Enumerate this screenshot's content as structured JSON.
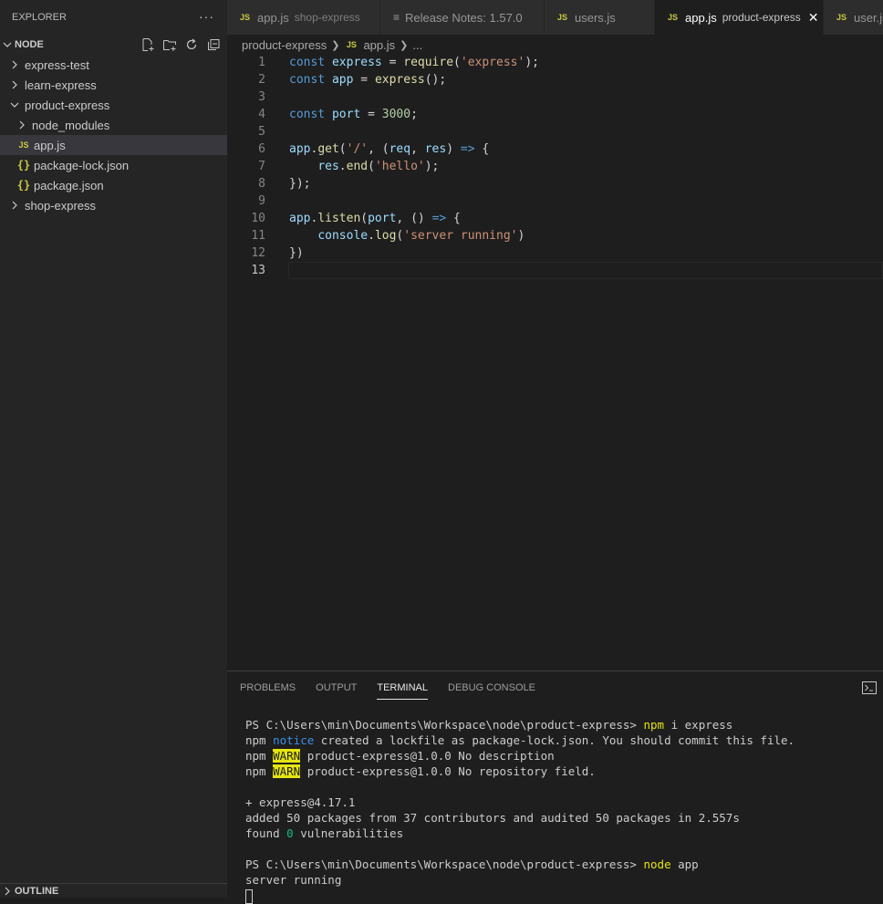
{
  "explorer": {
    "title": "EXPLORER",
    "more": "···",
    "section": "NODE",
    "tree": [
      {
        "label": "express-test",
        "type": "folder",
        "depth": 0,
        "expanded": false
      },
      {
        "label": "learn-express",
        "type": "folder",
        "depth": 0,
        "expanded": false
      },
      {
        "label": "product-express",
        "type": "folder",
        "depth": 0,
        "expanded": true
      },
      {
        "label": "node_modules",
        "type": "folder",
        "depth": 1,
        "expanded": false
      },
      {
        "label": "app.js",
        "type": "js",
        "depth": 1,
        "selected": true
      },
      {
        "label": "package-lock.json",
        "type": "json",
        "depth": 1
      },
      {
        "label": "package.json",
        "type": "json",
        "depth": 1
      },
      {
        "label": "shop-express",
        "type": "folder",
        "depth": 0,
        "expanded": false
      }
    ],
    "outline": "OUTLINE"
  },
  "icons": {
    "js": "JS",
    "json": "{}"
  },
  "tabs": [
    {
      "label": "app.js",
      "desc": "shop-express",
      "icon": "js",
      "active": false
    },
    {
      "label": "Release Notes: 1.57.0",
      "desc": "",
      "icon": "notes",
      "active": false
    },
    {
      "label": "users.js",
      "desc": "",
      "icon": "js",
      "active": false
    },
    {
      "label": "app.js",
      "desc": "product-express",
      "icon": "js",
      "active": true
    },
    {
      "label": "user.js",
      "desc": "",
      "icon": "js",
      "active": false
    }
  ],
  "breadcrumb": {
    "folder": "product-express",
    "file": "app.js",
    "rest": "..."
  },
  "code": [
    [
      [
        "kw",
        "const "
      ],
      [
        "var",
        "express"
      ],
      [
        "pun",
        " = "
      ],
      [
        "fn",
        "require"
      ],
      [
        "pun",
        "("
      ],
      [
        "str",
        "'express'"
      ],
      [
        "pun",
        ");"
      ]
    ],
    [
      [
        "kw",
        "const "
      ],
      [
        "var",
        "app"
      ],
      [
        "pun",
        " = "
      ],
      [
        "fn",
        "express"
      ],
      [
        "pun",
        "();"
      ]
    ],
    [],
    [
      [
        "kw",
        "const "
      ],
      [
        "var",
        "port"
      ],
      [
        "pun",
        " = "
      ],
      [
        "num",
        "3000"
      ],
      [
        "pun",
        ";"
      ]
    ],
    [],
    [
      [
        "var",
        "app"
      ],
      [
        "pun",
        "."
      ],
      [
        "fn",
        "get"
      ],
      [
        "pun",
        "("
      ],
      [
        "str",
        "'/'"
      ],
      [
        "pun",
        ", ("
      ],
      [
        "var",
        "req"
      ],
      [
        "pun",
        ", "
      ],
      [
        "var",
        "res"
      ],
      [
        "pun",
        ") "
      ],
      [
        "kw",
        "=>"
      ],
      [
        "pun",
        " {"
      ]
    ],
    [
      [
        "pun",
        "    "
      ],
      [
        "var",
        "res"
      ],
      [
        "pun",
        "."
      ],
      [
        "fn",
        "end"
      ],
      [
        "pun",
        "("
      ],
      [
        "str",
        "'hello'"
      ],
      [
        "pun",
        ");"
      ]
    ],
    [
      [
        "pun",
        "});"
      ]
    ],
    [],
    [
      [
        "var",
        "app"
      ],
      [
        "pun",
        "."
      ],
      [
        "fn",
        "listen"
      ],
      [
        "pun",
        "("
      ],
      [
        "var",
        "port"
      ],
      [
        "pun",
        ", () "
      ],
      [
        "kw",
        "=>"
      ],
      [
        "pun",
        " {"
      ]
    ],
    [
      [
        "pun",
        "    "
      ],
      [
        "var",
        "console"
      ],
      [
        "pun",
        "."
      ],
      [
        "fn",
        "log"
      ],
      [
        "pun",
        "("
      ],
      [
        "str",
        "'server running'"
      ],
      [
        "pun",
        ")"
      ]
    ],
    [
      [
        "pun",
        "})"
      ]
    ],
    []
  ],
  "current_line": 13,
  "panel": {
    "tabs": [
      {
        "label": "PROBLEMS",
        "active": false
      },
      {
        "label": "OUTPUT",
        "active": false
      },
      {
        "label": "TERMINAL",
        "active": true
      },
      {
        "label": "DEBUG CONSOLE",
        "active": false
      }
    ]
  },
  "terminal": [
    [
      [
        "plain",
        "PS C:\\Users\\min\\Documents\\Workspace\\node\\product-express> "
      ],
      [
        "yellow",
        "npm"
      ],
      [
        "plain",
        " i express"
      ]
    ],
    [
      [
        "plain",
        "npm "
      ],
      [
        "blue",
        "notice"
      ],
      [
        "plain",
        " created a lockfile as package-lock.json. You should commit this file."
      ]
    ],
    [
      [
        "plain",
        "npm "
      ],
      [
        "warn",
        "WARN"
      ],
      [
        "plain",
        " product-express@1.0.0 No description"
      ]
    ],
    [
      [
        "plain",
        "npm "
      ],
      [
        "warn",
        "WARN"
      ],
      [
        "plain",
        " product-express@1.0.0 No repository field."
      ]
    ],
    [],
    [
      [
        "plain",
        "+ express@4.17.1"
      ]
    ],
    [
      [
        "plain",
        "added 50 packages from 37 contributors and audited 50 packages in 2.557s"
      ]
    ],
    [
      [
        "plain",
        "found "
      ],
      [
        "green",
        "0"
      ],
      [
        "plain",
        " vulnerabilities"
      ]
    ],
    [],
    [
      [
        "plain",
        "PS C:\\Users\\min\\Documents\\Workspace\\node\\product-express> "
      ],
      [
        "yellow",
        "node"
      ],
      [
        "plain",
        " app"
      ]
    ],
    [
      [
        "plain",
        "server running"
      ]
    ],
    [
      [
        "cursor",
        ""
      ]
    ]
  ]
}
